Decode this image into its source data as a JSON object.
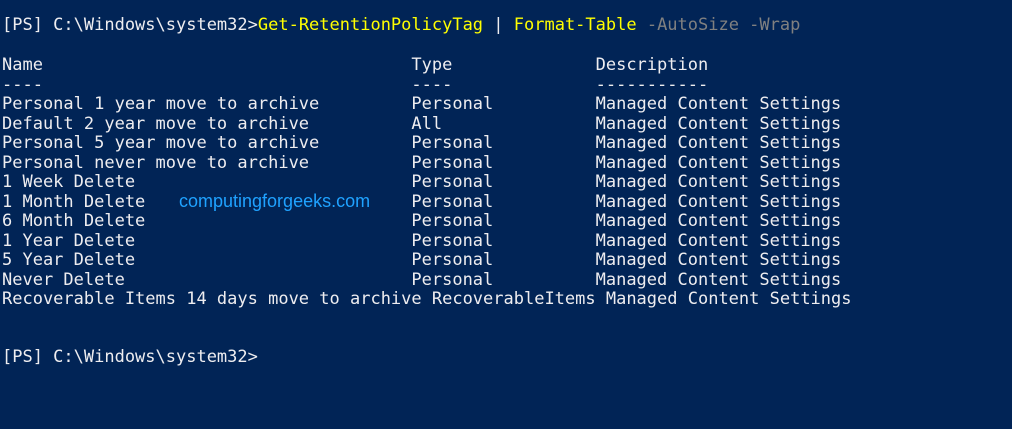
{
  "prompt1": "[PS] C:\\Windows\\system32>",
  "command": {
    "cmdlet": "Get-RetentionPolicyTag",
    "pipe": " | ",
    "cmdlet2": "Format-Table",
    "params": " -AutoSize -Wrap"
  },
  "table": {
    "header": "Name                                    Type              Description",
    "underline": "----                                    ----              -----------",
    "rows": [
      "Personal 1 year move to archive         Personal          Managed Content Settings",
      "Default 2 year move to archive          All               Managed Content Settings",
      "Personal 5 year move to archive         Personal          Managed Content Settings",
      "Personal never move to archive          Personal          Managed Content Settings",
      "1 Week Delete                           Personal          Managed Content Settings",
      "1 Month Delete                          Personal          Managed Content Settings",
      "6 Month Delete                          Personal          Managed Content Settings",
      "1 Year Delete                           Personal          Managed Content Settings",
      "5 Year Delete                           Personal          Managed Content Settings",
      "Never Delete                            Personal          Managed Content Settings",
      "Recoverable Items 14 days move to archive RecoverableItems Managed Content Settings"
    ]
  },
  "prompt2": "[PS] C:\\Windows\\system32>",
  "watermark": "computingforgeeks.com",
  "colors": {
    "background": "#012456",
    "text": "#eeedf0",
    "cmdlet": "#ffff00",
    "parameter": "#808080",
    "watermark": "#1fa2ff"
  }
}
